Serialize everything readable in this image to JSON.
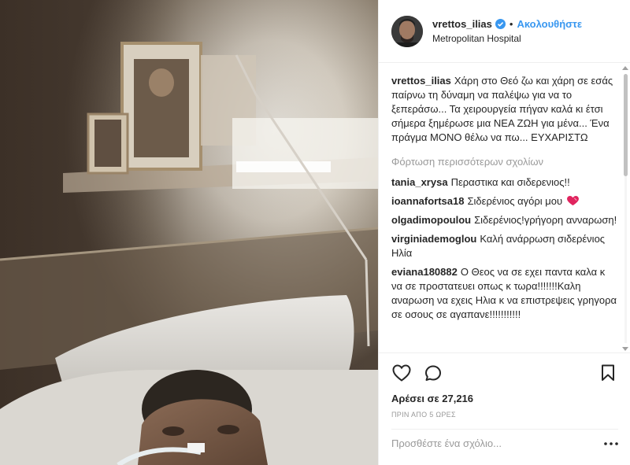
{
  "post": {
    "username": "vrettos_ilias",
    "separator": "•",
    "follow_label": "Ακολουθήστε",
    "location": "Metropolitan Hospital",
    "caption_user": "vrettos_ilias",
    "caption_text": "Χάρη στο Θεό ζω και χάρη σε εσάς παίρνω τη δύναμη να παλέψω για να το ξεπεράσω... Τα χειρουργεία πήγαν καλά κι έτσι σήμερα ξημέρωσε μια ΝΕΑ ΖΩΗ για μένα... Ένα πράγμα ΜΟΝΟ θέλω να πω... ΕΥΧΑΡΙΣΤΩ",
    "load_more_label": "Φόρτωση περισσότερων σχολίων"
  },
  "comments": [
    {
      "user": "tania_xrysa",
      "text": "Περαστικα και σιδερενιος!!"
    },
    {
      "user": "ioannafortsa18",
      "text": "Σιδερένιος αγόρι μου"
    },
    {
      "user": "olgadimopoulou",
      "text": "Σιδερένιος!γρήγορη ανναρωση!"
    },
    {
      "user": "virginiademoglou",
      "text": "Καλή ανάρρωση σιδερένιος Ηλία"
    },
    {
      "user": "eviana180882",
      "text": "Ο Θεος να σε εχει παντα καλα κ να σε προστατευει οπως κ τωρα!!!!!!!Καλη αναρωση να εχεις Ηλια κ να επιστρεψεις γρηγορα σε οσους σε αγαπανε!!!!!!!!!!!"
    }
  ],
  "footer": {
    "likes_label": "Αρέσει σε 27,216",
    "time_label": "ΠΡΙΝ ΑΠΟ 5 ΩΡΕΣ",
    "add_comment_placeholder": "Προσθέστε ένα σχόλιο..."
  },
  "icons": {
    "verified": "verified-badge-icon",
    "like": "heart-icon",
    "comment": "speech-bubble-icon",
    "save": "bookmark-icon",
    "more": "more-dots-icon",
    "emoji_in_comment": "red-heart-emoji"
  },
  "colors": {
    "accent": "#3897f0",
    "muted": "#999999",
    "text": "#262626",
    "heart_emoji": "#e0245e"
  }
}
